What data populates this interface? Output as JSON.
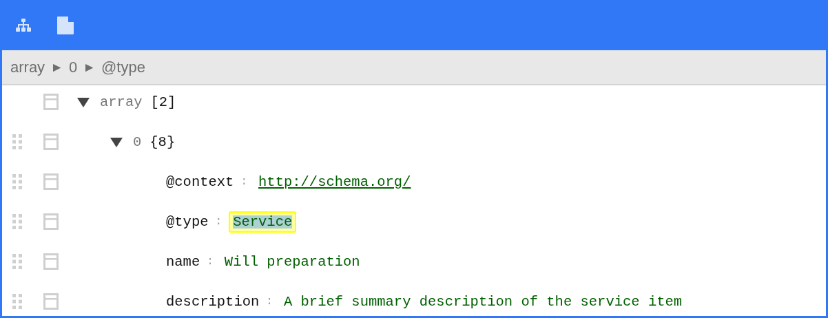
{
  "toolbar": {
    "buttons": [
      {
        "kind": "tree"
      },
      {
        "kind": "text"
      }
    ]
  },
  "breadcrumb": {
    "separator": "►",
    "items": [
      "array",
      "0",
      "@type"
    ]
  },
  "tree": {
    "key": "array",
    "kind": "array",
    "count": "[2]",
    "expanded": true,
    "children": [
      {
        "key": "0",
        "kind": "object",
        "count": "{8}",
        "expanded": true,
        "children": [
          {
            "key": "@context",
            "separator": ":",
            "kind": "link",
            "value": "http://schema.org/",
            "selected": false
          },
          {
            "key": "@type",
            "separator": ":",
            "kind": "string",
            "value": "Service",
            "selected": true
          },
          {
            "key": "name",
            "separator": ":",
            "kind": "string",
            "value": "Will preparation",
            "selected": false
          },
          {
            "key": "description",
            "separator": ":",
            "kind": "string",
            "value": "A brief summary description of the service item",
            "selected": false
          }
        ]
      }
    ]
  }
}
